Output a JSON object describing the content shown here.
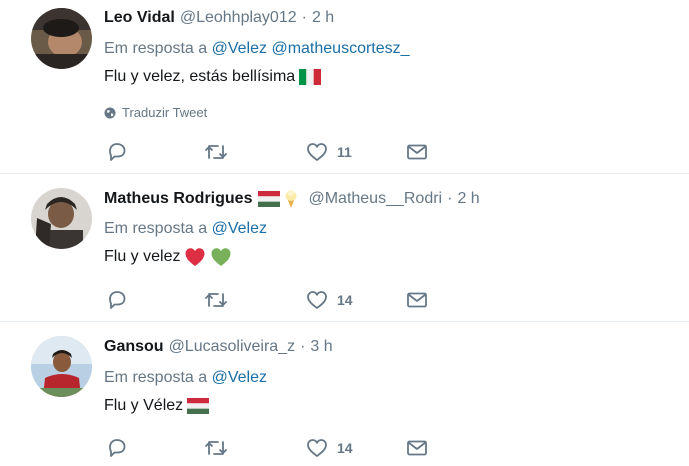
{
  "tweets": [
    {
      "name": "Leo Vidal",
      "handle": "@Leohhplay012",
      "time": "2 h",
      "reply_prefix": "Em resposta a",
      "mentions": [
        "@Velez",
        "@matheuscortesz_"
      ],
      "text": "Flu y velez, estás bellísima",
      "translate_label": "Traduzir Tweet",
      "reply_count": "",
      "retweet_count": "",
      "like_count": "11"
    },
    {
      "name": "Matheus Rodrigues",
      "handle": "@Matheus__Rodri",
      "time": "2 h",
      "reply_prefix": "Em resposta a",
      "mentions": [
        "@Velez"
      ],
      "text": "Flu y velez",
      "reply_count": "",
      "retweet_count": "",
      "like_count": "14"
    },
    {
      "name": "Gansou",
      "handle": "@Lucasoliveira_z",
      "time": "3 h",
      "reply_prefix": "Em resposta a",
      "mentions": [
        "@Velez"
      ],
      "text": "Flu y Vélez",
      "reply_count": "",
      "retweet_count": "",
      "like_count": "14"
    }
  ],
  "separator": "·",
  "icons": {
    "reply": "reply-icon",
    "retweet": "retweet-icon",
    "like": "heart-icon",
    "dm": "envelope-icon",
    "globe": "globe-icon"
  },
  "colors": {
    "text": "#14171a",
    "muted": "#657786",
    "link": "#1b6fa6",
    "divider": "#e6ecf0",
    "heart_red": "#dd2e44",
    "heart_green": "#78b159"
  }
}
